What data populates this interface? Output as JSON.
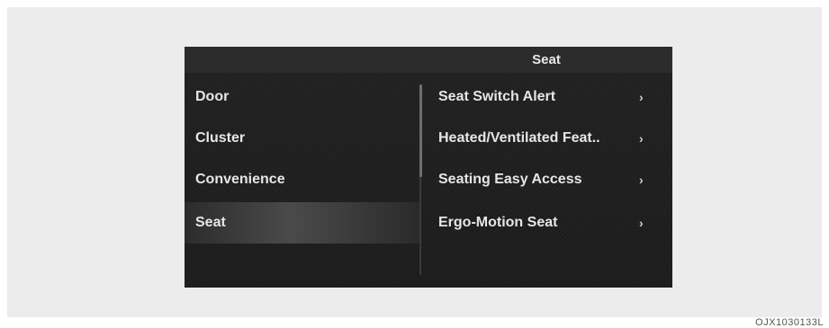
{
  "header": {
    "title": "Seat"
  },
  "left_menu": {
    "items": [
      {
        "label": "Door",
        "selected": false
      },
      {
        "label": "Cluster",
        "selected": false
      },
      {
        "label": "Convenience",
        "selected": false
      },
      {
        "label": "Seat",
        "selected": true
      }
    ]
  },
  "right_menu": {
    "items": [
      {
        "label": "Seat Switch Alert",
        "icon": "chevron-right-icon"
      },
      {
        "label": "Heated/Ventilated Feat..",
        "icon": "chevron-right-icon"
      },
      {
        "label": "Seating Easy Access",
        "icon": "chevron-right-icon"
      },
      {
        "label": "Ergo-Motion Seat",
        "icon": "chevron-right-icon"
      }
    ]
  },
  "chevron_glyph": "›",
  "footer": {
    "ref_code": "OJX1030133L"
  },
  "colors": {
    "screen_background": "#1e1e1e",
    "header_background": "#2c2c2c",
    "text": "#e6e6e6",
    "selected_highlight": "#4a4a4a",
    "outer_panel": "#ececec"
  }
}
